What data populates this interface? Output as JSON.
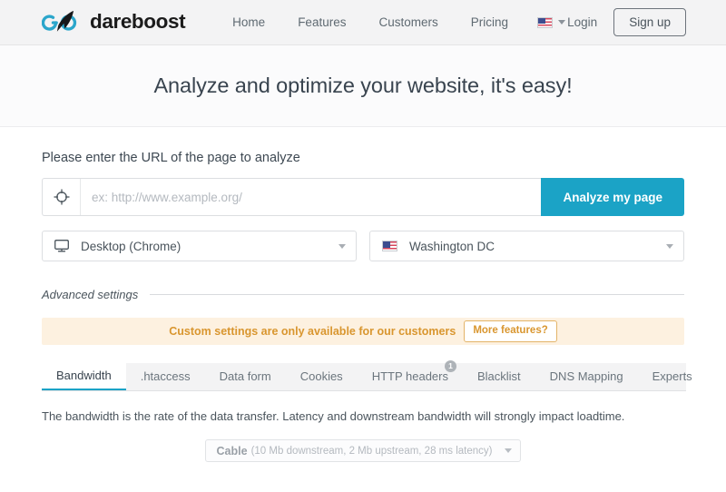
{
  "header": {
    "brand_name": "dareboost",
    "brand_logo_icon": "dareboost-rocket-logo",
    "nav_links": [
      {
        "label": "Home"
      },
      {
        "label": "Features"
      },
      {
        "label": "Customers"
      },
      {
        "label": "Pricing"
      }
    ],
    "language": {
      "flag_icon": "us-flag-icon",
      "caret_icon": "chevron-down-icon"
    },
    "login_label": "Login",
    "signup_label": "Sign up"
  },
  "hero": {
    "title": "Analyze and optimize your website, it's easy!"
  },
  "form": {
    "label": "Please enter the URL of the page to analyze",
    "url_icon": "crosshair-target-icon",
    "url_value": "",
    "url_placeholder": "ex: http://www.example.org/",
    "analyze_label": "Analyze my page",
    "device_select": {
      "icon": "desktop-monitor-icon",
      "value": "Desktop (Chrome)"
    },
    "location_select": {
      "icon": "us-flag-icon",
      "value": "Washington DC"
    }
  },
  "advanced": {
    "title": "Advanced settings",
    "notice_text": "Custom settings are only available for our customers",
    "notice_button": "More features?",
    "tabs": [
      {
        "label": "Bandwidth",
        "active": true,
        "badge": ""
      },
      {
        "label": ".htaccess",
        "active": false,
        "badge": ""
      },
      {
        "label": "Data form",
        "active": false,
        "badge": ""
      },
      {
        "label": "Cookies",
        "active": false,
        "badge": ""
      },
      {
        "label": "HTTP headers",
        "active": false,
        "badge": "1"
      },
      {
        "label": "Blacklist",
        "active": false,
        "badge": ""
      },
      {
        "label": "DNS Mapping",
        "active": false,
        "badge": ""
      },
      {
        "label": "Experts",
        "active": false,
        "badge": ""
      }
    ],
    "tab_description": "The bandwidth is the rate of the data transfer. Latency and downstream bandwidth will strongly impact loadtime.",
    "bandwidth_select": {
      "name": "Cable",
      "detail": "(10 Mb downstream, 2 Mb upstream, 28 ms latency)"
    }
  },
  "colors": {
    "accent": "#1ba3c6",
    "notice_text": "#d9962f",
    "notice_bg": "#fdf1e0",
    "header_bg": "#f3f3f4",
    "heading": "#39444f"
  }
}
